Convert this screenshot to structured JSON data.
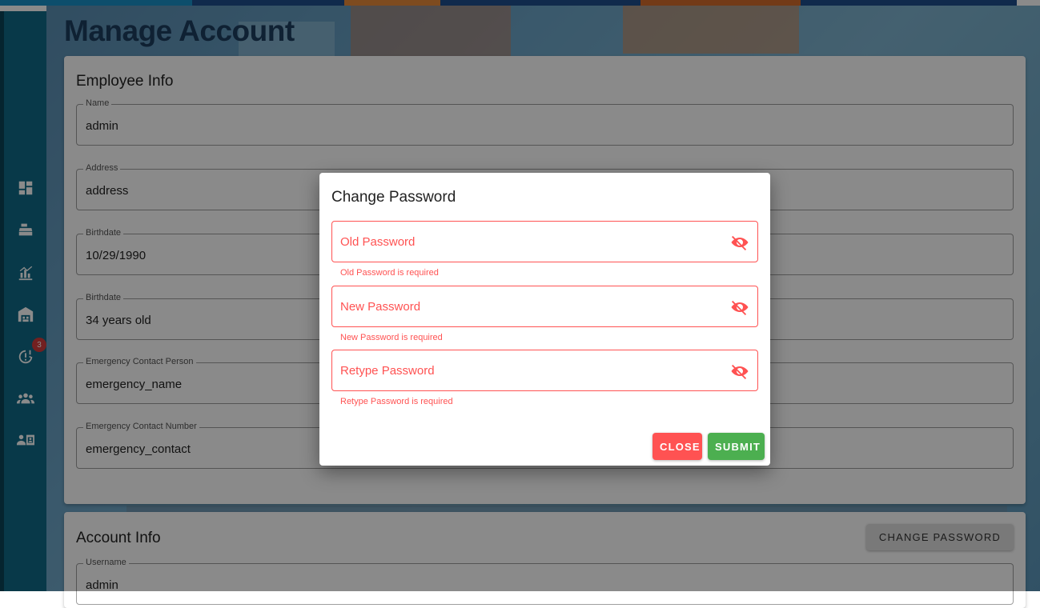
{
  "page": {
    "title": "Manage Account"
  },
  "sidebar": {
    "items": [
      {
        "icon": "dashboard-icon"
      },
      {
        "icon": "cash-register-icon"
      },
      {
        "icon": "sales-chart-icon"
      },
      {
        "icon": "warehouse-icon"
      },
      {
        "icon": "alert-clock-icon",
        "badge": "3"
      },
      {
        "icon": "group-icon"
      },
      {
        "icon": "account-box-icon"
      }
    ]
  },
  "employee_info": {
    "title": "Employee Info",
    "fields": [
      {
        "label": "Name",
        "value": "admin"
      },
      {
        "label": "Address",
        "value": "address"
      },
      {
        "label": "Birthdate",
        "value": "10/29/1990"
      },
      {
        "label": "Birthdate",
        "value": "34 years old"
      },
      {
        "label": "Emergency Contact Person",
        "value": "emergency_name"
      },
      {
        "label": "Emergency Contact Number",
        "value": "emergency_contact"
      }
    ]
  },
  "account_info": {
    "title": "Account Info",
    "change_password_label": "CHANGE PASSWORD",
    "fields": [
      {
        "label": "Username",
        "value": "admin"
      }
    ]
  },
  "dialog": {
    "title": "Change Password",
    "fields": [
      {
        "placeholder": "Old Password",
        "error": "Old Password is required"
      },
      {
        "placeholder": "New Password",
        "error": "New Password is required"
      },
      {
        "placeholder": "Retype Password",
        "error": "Retype Password is required"
      }
    ],
    "close_label": "CLOSE",
    "submit_label": "SUBMIT"
  },
  "colors": {
    "sidebar": "#0f6a87",
    "error": "#ff5252",
    "submit": "#4caf50",
    "close": "#ff5252",
    "title": "#1c3d5e"
  }
}
